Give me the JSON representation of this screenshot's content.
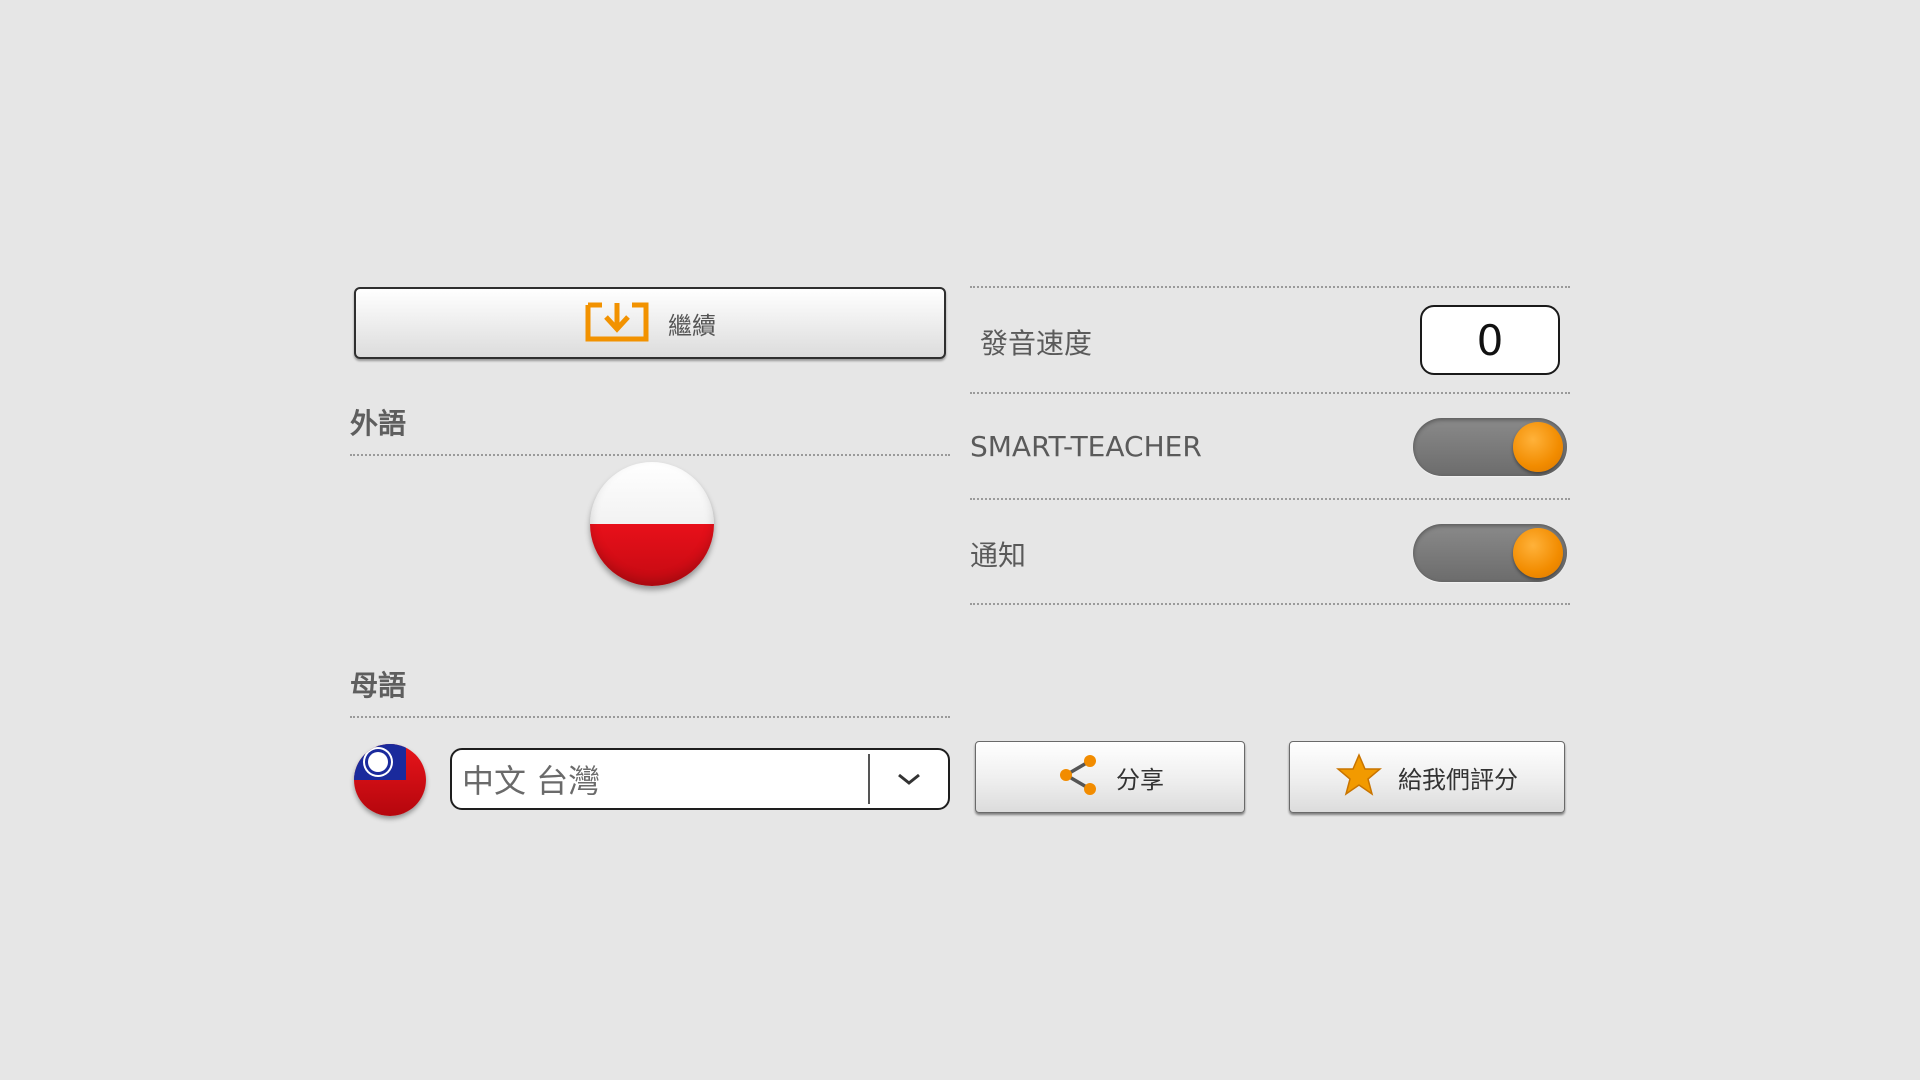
{
  "continue_button": {
    "label": "繼續",
    "icon": "download-icon"
  },
  "foreign_language": {
    "title": "外語",
    "flag_icon": "poland-flag-icon"
  },
  "native_language": {
    "title": "母語",
    "flag_icon": "taiwan-flag-icon",
    "selected": "中文 台灣"
  },
  "settings": {
    "speed_label": "發音速度",
    "speed_value": "0",
    "smart_teacher_label": "SMART-TEACHER",
    "smart_teacher_on": true,
    "notifications_label": "通知",
    "notifications_on": true
  },
  "actions": {
    "share_label": "分享",
    "rate_label": "給我們評分"
  },
  "colors": {
    "background": "#e6e6e6",
    "accent": "#f28c00",
    "toggle_track": "#7a7a7a"
  }
}
